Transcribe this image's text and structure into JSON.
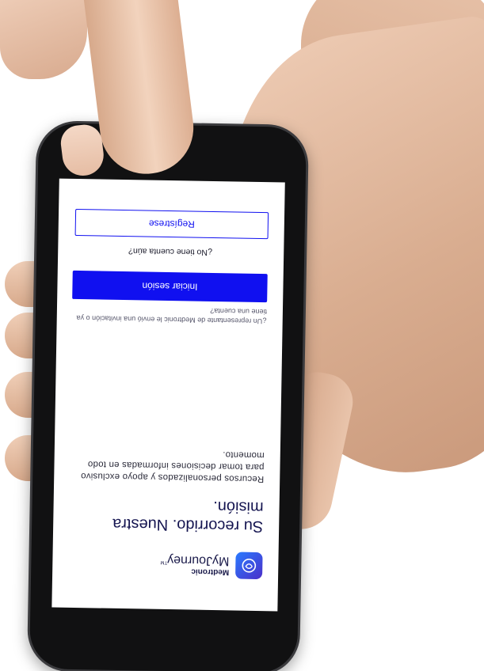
{
  "app": {
    "company": "Medtronic",
    "product": "MyJourney",
    "trademark": "TM",
    "icon": "brain-heart-app-icon"
  },
  "hero": {
    "title": "Su recorrido. Nuestra misión.",
    "body": "Recursos personalizados y apoyo exclusivo para tomar decisiones informadas en todo momento."
  },
  "login": {
    "invite_prompt": "¿Un representante de Medtronic le envió una invitación o ya tiene una cuenta?",
    "signin_label": "Iniciar sesión",
    "no_account_prompt": "¿No tiene cuenta aún?",
    "register_label": "Regístrese"
  },
  "colors": {
    "primary_button": "#1010f0",
    "title_text": "#141450",
    "phone_body": "#111112",
    "skin": "#ddb49a"
  }
}
